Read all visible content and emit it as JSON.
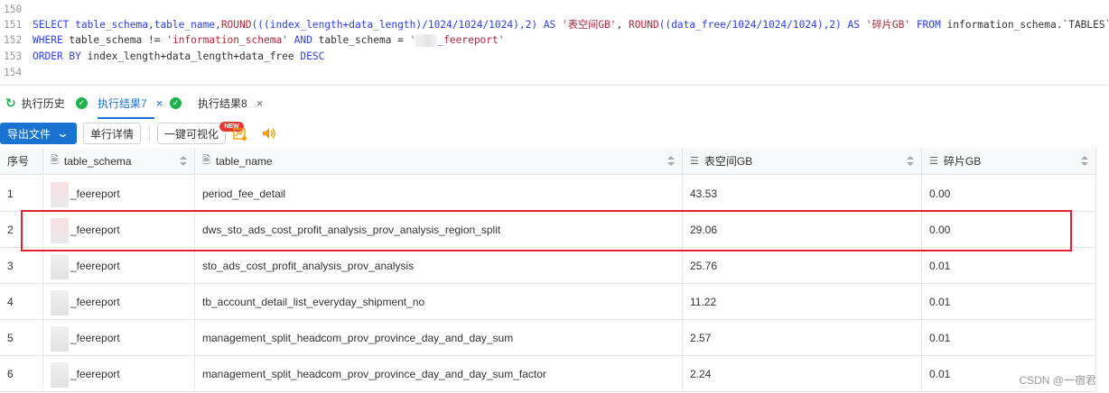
{
  "editor": {
    "lines": [
      {
        "num": "150"
      },
      {
        "num": "151",
        "parts": [
          {
            "t": "SELECT table_schema,table_name,",
            "c": "kw"
          },
          {
            "t": "ROUND",
            "c": "fn"
          },
          {
            "t": "(((index_length+data_length)/1024/1024/1024),2) ",
            "c": "kw"
          },
          {
            "t": "AS ",
            "c": "kw"
          },
          {
            "t": "'表空间GB'",
            "c": "str"
          },
          {
            "t": ", ",
            "c": "sym"
          },
          {
            "t": "ROUND",
            "c": "fn"
          },
          {
            "t": "((data_free/1024/1024/1024),2) ",
            "c": "kw"
          },
          {
            "t": "AS ",
            "c": "kw"
          },
          {
            "t": "'碎片GB'",
            "c": "str"
          },
          {
            "t": " FROM ",
            "c": "kw"
          },
          {
            "t": "information_schema.`TABLES`",
            "c": "sym"
          }
        ]
      },
      {
        "num": "152",
        "parts": [
          {
            "t": "WHERE ",
            "c": "kw"
          },
          {
            "t": "table_schema != ",
            "c": "sym"
          },
          {
            "t": "'information_schema'",
            "c": "str"
          },
          {
            "t": " AND ",
            "c": "kw"
          },
          {
            "t": "table_schema = ",
            "c": "sym"
          },
          {
            "t": "'",
            "c": "str"
          },
          {
            "mask": true
          },
          {
            "t": "_feereport'",
            "c": "str"
          }
        ]
      },
      {
        "num": "153",
        "parts": [
          {
            "t": "ORDER BY ",
            "c": "kw"
          },
          {
            "t": "index_length+data_length+data_free ",
            "c": "sym"
          },
          {
            "t": "DESC",
            "c": "kw"
          }
        ]
      },
      {
        "num": "154"
      }
    ]
  },
  "tabs": [
    {
      "label": "执行历史",
      "icon": "history-icon"
    },
    {
      "label": "执行结果7",
      "icon": "success-check-icon",
      "active": true,
      "closable": true
    },
    {
      "label": "执行结果8",
      "icon": "success-check-icon",
      "closable": true
    }
  ],
  "toolbar": {
    "export_label": "导出文件",
    "detail_label": "单行详情",
    "visualize_label": "一键可视化",
    "new_badge": "NEW"
  },
  "grid": {
    "columns": [
      {
        "label": "序号"
      },
      {
        "label": "table_schema",
        "icon": "text-column-icon"
      },
      {
        "label": "table_name",
        "icon": "text-column-icon"
      },
      {
        "label": "表空间GB",
        "icon": "number-column-icon"
      },
      {
        "label": "碎片GB",
        "icon": "number-column-icon"
      }
    ],
    "rows": [
      {
        "idx": "1",
        "schema": "_feereport",
        "name": "period_fee_detail",
        "space": "43.53",
        "frag": "0.00"
      },
      {
        "idx": "2",
        "schema": "_feereport",
        "name": "dws_sto_ads_cost_profit_analysis_prov_analysis_region_split",
        "space": "29.06",
        "frag": "0.00",
        "highlighted": true
      },
      {
        "idx": "3",
        "schema": "_feereport",
        "name": "sto_ads_cost_profit_analysis_prov_analysis",
        "space": "25.76",
        "frag": "0.01"
      },
      {
        "idx": "4",
        "schema": "_feereport",
        "name": "tb_account_detail_list_everyday_shipment_no",
        "space": "11.22",
        "frag": "0.01"
      },
      {
        "idx": "5",
        "schema": "_feereport",
        "name": "management_split_headcom_prov_province_day_and_day_sum",
        "space": "2.57",
        "frag": "0.01"
      },
      {
        "idx": "6",
        "schema": "_feereport",
        "name": "management_split_headcom_prov_province_day_and_day_sum_factor",
        "space": "2.24",
        "frag": "0.01"
      }
    ]
  },
  "watermark": "CSDN @一宿君",
  "colors": {
    "accent": "#1a73d0",
    "success": "#1db24a",
    "highlight_border": "#e0232f"
  }
}
